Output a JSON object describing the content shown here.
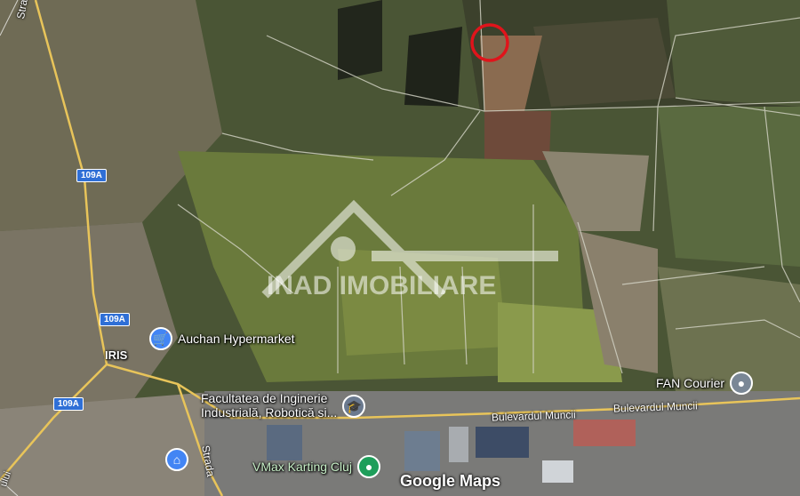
{
  "map": {
    "roads": {
      "badge_a": "109A",
      "badge_b": "109A",
      "badge_c": "109A",
      "top_street": "Strada Oașului",
      "left_street": "ului",
      "bottom_street": "Strada",
      "boulevard_1": "Bulevardul Muncii",
      "boulevard_2": "Bulevardul Muncii"
    },
    "places": {
      "district": "IRIS",
      "auchan": "Auchan Hypermarket",
      "faculty_line1": "Facultatea de Inginerie",
      "faculty_line2": "Industrială, Robotică si...",
      "fan": "FAN Courier",
      "vmax": "VMax Karting Cluj"
    },
    "watermark": "INAD IMOBILIARE",
    "attribution": "Google Maps",
    "marker_color": "#e0141b",
    "icons": {
      "auchan": "shopping-cart-icon",
      "faculty": "graduation-cap-icon",
      "fan": "place-pin-icon",
      "vmax": "place-pin-icon",
      "home": "house-icon"
    }
  }
}
